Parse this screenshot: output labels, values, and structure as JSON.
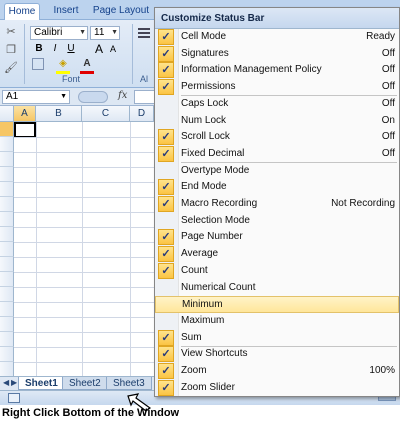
{
  "ribbon": {
    "tabs": [
      "Home",
      "Insert",
      "Page Layout"
    ],
    "font_name": "Calibri",
    "font_size": "11",
    "bold_label": "B",
    "italic_label": "I",
    "underline_label": "U",
    "grow_label": "A",
    "shrink_label": "A",
    "groups": [
      "Font",
      "Al"
    ],
    "clipboard_icons": [
      "cut-icon",
      "copy-icon",
      "format-painter-icon"
    ]
  },
  "formula_bar": {
    "name_box": "A1",
    "fx_label": "fx"
  },
  "grid": {
    "columns": [
      "A",
      "B",
      "C",
      "D"
    ]
  },
  "sheets": [
    "Sheet1",
    "Sheet2",
    "Sheet3"
  ],
  "menu": {
    "title": "Customize Status Bar",
    "items": [
      {
        "label": "Cell Mode",
        "value": "Ready",
        "checked": true
      },
      {
        "label": "Signatures",
        "value": "Off",
        "checked": true
      },
      {
        "label": "Information Management Policy",
        "value": "Off",
        "checked": true
      },
      {
        "label": "Permissions",
        "value": "Off",
        "checked": true
      },
      {
        "label": "Caps Lock",
        "value": "Off",
        "checked": false
      },
      {
        "label": "Num Lock",
        "value": "On",
        "checked": false
      },
      {
        "label": "Scroll Lock",
        "value": "Off",
        "checked": true
      },
      {
        "label": "Fixed Decimal",
        "value": "Off",
        "checked": true
      },
      {
        "label": "Overtype Mode",
        "value": "",
        "checked": false
      },
      {
        "label": "End Mode",
        "value": "",
        "checked": true
      },
      {
        "label": "Macro Recording",
        "value": "Not Recording",
        "checked": true
      },
      {
        "label": "Selection Mode",
        "value": "",
        "checked": false
      },
      {
        "label": "Page Number",
        "value": "",
        "checked": true
      },
      {
        "label": "Average",
        "value": "",
        "checked": true
      },
      {
        "label": "Count",
        "value": "",
        "checked": true
      },
      {
        "label": "Numerical Count",
        "value": "",
        "checked": false
      },
      {
        "label": "Minimum",
        "value": "",
        "checked": false,
        "highlighted": true
      },
      {
        "label": "Maximum",
        "value": "",
        "checked": false
      },
      {
        "label": "Sum",
        "value": "",
        "checked": true
      },
      {
        "label": "View Shortcuts",
        "value": "",
        "checked": true
      },
      {
        "label": "Zoom",
        "value": "100%",
        "checked": true
      },
      {
        "label": "Zoom Slider",
        "value": "",
        "checked": true
      }
    ]
  },
  "caption": "Right Click Bottom of the Window"
}
